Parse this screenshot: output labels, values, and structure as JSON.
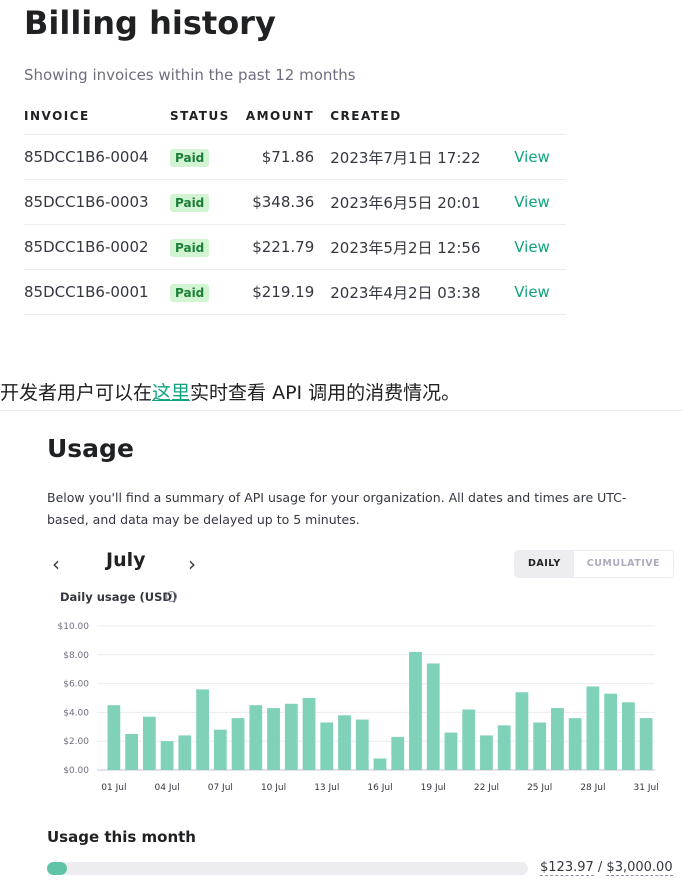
{
  "billing": {
    "title": "Billing history",
    "subtitle": "Showing invoices within the past 12 months",
    "columns": [
      "INVOICE",
      "STATUS",
      "AMOUNT",
      "CREATED"
    ],
    "rows": [
      {
        "invoice": "85DCC1B6-0004",
        "status": "Paid",
        "amount": "$71.86",
        "created": "2023年7月1日 17:22",
        "action": "View"
      },
      {
        "invoice": "85DCC1B6-0003",
        "status": "Paid",
        "amount": "$348.36",
        "created": "2023年6月5日 20:01",
        "action": "View"
      },
      {
        "invoice": "85DCC1B6-0002",
        "status": "Paid",
        "amount": "$221.79",
        "created": "2023年5月2日 12:56",
        "action": "View"
      },
      {
        "invoice": "85DCC1B6-0001",
        "status": "Paid",
        "amount": "$219.19",
        "created": "2023年4月2日 03:38",
        "action": "View"
      }
    ]
  },
  "note": {
    "before": "开发者用户可以在",
    "link": "这里",
    "after": "实时查看 API 调用的消费情况。"
  },
  "usage": {
    "title": "Usage",
    "description": "Below you'll find a summary of API usage for your organization. All dates and times are UTC-based, and data may be delayed up to 5 minutes.",
    "month": "July",
    "toggle": {
      "daily": "DAILY",
      "cumulative": "CUMULATIVE"
    },
    "chart_title": "Daily usage (USD)",
    "month_section_title": "Usage this month",
    "spent": "$123.97",
    "separator": " / ",
    "limit": "$3,000.00",
    "progress_fraction": 0.041
  },
  "colors": {
    "accent": "#10a37f",
    "bar": "#7fd1b9",
    "badge_bg": "#d2f4d3",
    "badge_text": "#1a7f37"
  },
  "icons": {
    "prev": "chevron-left-icon",
    "next": "chevron-right-icon",
    "info": "info-icon"
  },
  "chart_data": {
    "type": "bar",
    "title": "Daily usage (USD)",
    "xlabel": "",
    "ylabel": "",
    "ylim": [
      0,
      10
    ],
    "y_ticks": [
      "$0.00",
      "$2.00",
      "$4.00",
      "$6.00",
      "$8.00",
      "$10.00"
    ],
    "x_tick_labels": [
      "01 Jul",
      "04 Jul",
      "07 Jul",
      "10 Jul",
      "13 Jul",
      "16 Jul",
      "19 Jul",
      "22 Jul",
      "25 Jul",
      "28 Jul",
      "31 Jul"
    ],
    "categories": [
      "01 Jul",
      "02 Jul",
      "03 Jul",
      "04 Jul",
      "05 Jul",
      "06 Jul",
      "07 Jul",
      "08 Jul",
      "09 Jul",
      "10 Jul",
      "11 Jul",
      "12 Jul",
      "13 Jul",
      "14 Jul",
      "15 Jul",
      "16 Jul",
      "17 Jul",
      "18 Jul",
      "19 Jul",
      "20 Jul",
      "21 Jul",
      "22 Jul",
      "23 Jul",
      "24 Jul",
      "25 Jul",
      "26 Jul",
      "27 Jul",
      "28 Jul",
      "29 Jul",
      "30 Jul",
      "31 Jul"
    ],
    "values": [
      4.5,
      2.5,
      3.7,
      2.0,
      2.4,
      5.6,
      2.8,
      3.6,
      4.5,
      4.3,
      4.6,
      5.0,
      3.3,
      3.8,
      3.5,
      0.8,
      2.3,
      8.2,
      7.4,
      2.6,
      4.2,
      2.4,
      3.1,
      5.4,
      3.3,
      4.3,
      3.6,
      5.8,
      5.3,
      4.7,
      3.6
    ],
    "grid": true
  }
}
